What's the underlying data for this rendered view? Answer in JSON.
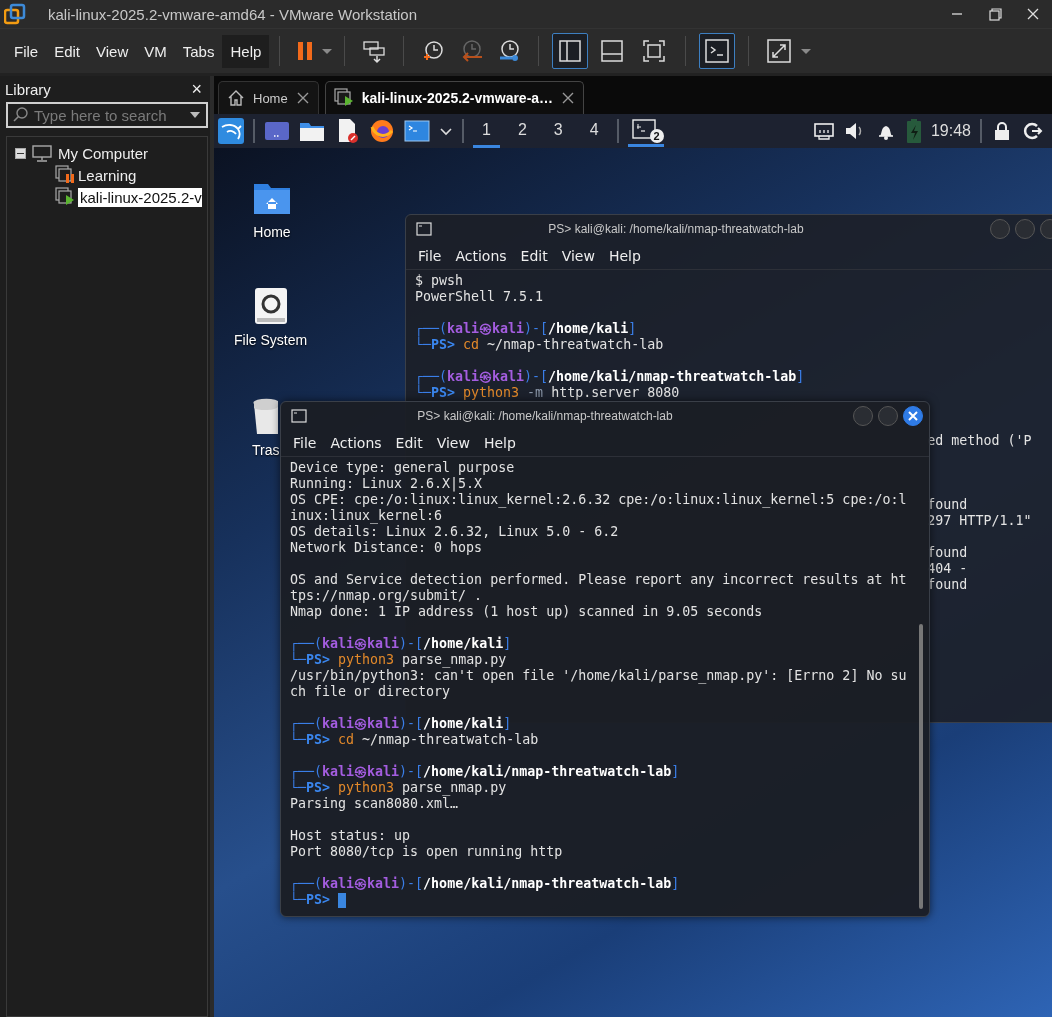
{
  "window": {
    "title": "kali-linux-2025.2-vmware-amd64 - VMware Workstation"
  },
  "menu": [
    {
      "label": "File",
      "selected": false
    },
    {
      "label": "Edit",
      "selected": false
    },
    {
      "label": "View",
      "selected": false
    },
    {
      "label": "VM",
      "selected": false
    },
    {
      "label": "Tabs",
      "selected": false
    },
    {
      "label": "Help",
      "selected": true
    }
  ],
  "toolbar": {
    "view_buttons": [
      {
        "selected": true
      },
      {
        "selected": false
      },
      {
        "selected": false
      }
    ],
    "console_view": {
      "selected": true
    }
  },
  "library": {
    "title": "Library",
    "close": "×",
    "search": {
      "placeholder": "Type here to search"
    },
    "tree": [
      {
        "label": "My Computer",
        "expanded": true,
        "children": [
          {
            "label": "Learning",
            "kind": "paused",
            "selected": false
          },
          {
            "label": "kali-linux-2025.2-v",
            "kind": "running",
            "selected": true
          }
        ]
      }
    ]
  },
  "tabs": [
    {
      "label": "Home",
      "kind": "home",
      "selected": false
    },
    {
      "label": "kali-linux-2025.2-vmware-a…",
      "kind": "vm",
      "selected": true
    }
  ],
  "kali_panel": {
    "workspaces": [
      {
        "label": "1",
        "selected": true
      },
      {
        "label": "2",
        "selected": false
      },
      {
        "label": "3",
        "selected": false
      },
      {
        "label": "4",
        "selected": false
      }
    ],
    "task_badge": "2",
    "clock": "19:48"
  },
  "desktop_icons": [
    {
      "label": "Home",
      "kind": "folder"
    },
    {
      "label": "File System",
      "kind": "drive"
    },
    {
      "label": "Tras",
      "kind": "trash"
    }
  ],
  "terminals": [
    {
      "title": "PS> kali@kali: /home/kali/nmap-threatwatch-lab",
      "active": false,
      "menu": [
        "File",
        "Actions",
        "Edit",
        "View",
        "Help"
      ],
      "lines": [
        {
          "kind": "text",
          "parts": [
            {
              "kind": "text",
              "text": "$ pwsh"
            }
          ]
        },
        {
          "kind": "text",
          "parts": [
            {
              "kind": "text",
              "text": "PowerShell 7.5.1"
            }
          ]
        },
        {
          "kind": "blank"
        },
        {
          "kind": "text",
          "parts": [
            {
              "kind": "frame",
              "text": "┌──("
            },
            {
              "kind": "user",
              "text": "kali㉿kali"
            },
            {
              "kind": "frame",
              "text": ")-["
            },
            {
              "kind": "path",
              "text": "/home/kali"
            },
            {
              "kind": "frame",
              "text": "]"
            }
          ]
        },
        {
          "kind": "text",
          "parts": [
            {
              "kind": "frame",
              "text": "└─"
            },
            {
              "kind": "ps",
              "text": "PS>"
            },
            {
              "kind": "cmd",
              "text": " cd"
            },
            {
              "kind": "text",
              "text": " ~/nmap-threatwatch-lab"
            }
          ]
        },
        {
          "kind": "blank"
        },
        {
          "kind": "text",
          "parts": [
            {
              "kind": "frame",
              "text": "┌──("
            },
            {
              "kind": "user",
              "text": "kali㉿kali"
            },
            {
              "kind": "frame",
              "text": ")-["
            },
            {
              "kind": "path",
              "text": "/home/kali/nmap-threatwatch-lab"
            },
            {
              "kind": "frame",
              "text": "]"
            }
          ]
        },
        {
          "kind": "text",
          "parts": [
            {
              "kind": "frame",
              "text": "└─"
            },
            {
              "kind": "ps",
              "text": "PS>"
            },
            {
              "kind": "cmd",
              "text": " python3"
            },
            {
              "kind": "opt",
              "text": " -m"
            },
            {
              "kind": "text",
              "text": " http.server 8080"
            }
          ]
        },
        {
          "kind": "blank"
        },
        {
          "kind": "blank"
        },
        {
          "kind": "tail",
          "parts": [
            {
              "kind": "text",
              "text": "ed method ('P"
            }
          ]
        },
        {
          "kind": "blank"
        },
        {
          "kind": "blank"
        },
        {
          "kind": "blank"
        },
        {
          "kind": "tail",
          "parts": [
            {
              "kind": "text",
              "text": "found"
            }
          ]
        },
        {
          "kind": "tail",
          "parts": [
            {
              "kind": "text",
              "text": "297 HTTP/1.1\""
            }
          ]
        },
        {
          "kind": "blank"
        },
        {
          "kind": "tail",
          "parts": [
            {
              "kind": "text",
              "text": "found"
            }
          ]
        },
        {
          "kind": "tail",
          "parts": [
            {
              "kind": "text",
              "text": "404 -"
            }
          ]
        },
        {
          "kind": "tail",
          "parts": [
            {
              "kind": "text",
              "text": "found"
            }
          ]
        }
      ]
    },
    {
      "title": "PS> kali@kali: /home/kali/nmap-threatwatch-lab",
      "active": true,
      "menu": [
        "File",
        "Actions",
        "Edit",
        "View",
        "Help"
      ],
      "lines": [
        {
          "kind": "text",
          "parts": [
            {
              "kind": "text",
              "text": "Device type: general purpose"
            }
          ]
        },
        {
          "kind": "text",
          "parts": [
            {
              "kind": "text",
              "text": "Running: Linux 2.6.X|5.X"
            }
          ]
        },
        {
          "kind": "text",
          "parts": [
            {
              "kind": "text",
              "text": "OS CPE: cpe:/o:linux:linux_kernel:2.6.32 cpe:/o:linux:linux_kernel:5 cpe:/o:l"
            }
          ]
        },
        {
          "kind": "text",
          "parts": [
            {
              "kind": "text",
              "text": "inux:linux_kernel:6"
            }
          ]
        },
        {
          "kind": "text",
          "parts": [
            {
              "kind": "text",
              "text": "OS details: Linux 2.6.32, Linux 5.0 - 6.2"
            }
          ]
        },
        {
          "kind": "text",
          "parts": [
            {
              "kind": "text",
              "text": "Network Distance: 0 hops"
            }
          ]
        },
        {
          "kind": "blank"
        },
        {
          "kind": "text",
          "parts": [
            {
              "kind": "text",
              "text": "OS and Service detection performed. Please report any incorrect results at ht"
            }
          ]
        },
        {
          "kind": "text",
          "parts": [
            {
              "kind": "text",
              "text": "tps://nmap.org/submit/ ."
            }
          ]
        },
        {
          "kind": "text",
          "parts": [
            {
              "kind": "text",
              "text": "Nmap done: 1 IP address (1 host up) scanned in 9.05 seconds"
            }
          ]
        },
        {
          "kind": "blank"
        },
        {
          "kind": "text",
          "parts": [
            {
              "kind": "frame",
              "text": "┌──("
            },
            {
              "kind": "user",
              "text": "kali㉿kali"
            },
            {
              "kind": "frame",
              "text": ")-["
            },
            {
              "kind": "path",
              "text": "/home/kali"
            },
            {
              "kind": "frame",
              "text": "]"
            }
          ]
        },
        {
          "kind": "text",
          "parts": [
            {
              "kind": "frame",
              "text": "└─"
            },
            {
              "kind": "ps",
              "text": "PS>"
            },
            {
              "kind": "cmd",
              "text": " python3"
            },
            {
              "kind": "text",
              "text": " parse_nmap.py"
            }
          ]
        },
        {
          "kind": "text",
          "parts": [
            {
              "kind": "text",
              "text": "/usr/bin/python3: can't open file '/home/kali/parse_nmap.py': [Errno 2] No su"
            }
          ]
        },
        {
          "kind": "text",
          "parts": [
            {
              "kind": "text",
              "text": "ch file or directory"
            }
          ]
        },
        {
          "kind": "blank"
        },
        {
          "kind": "text",
          "parts": [
            {
              "kind": "frame",
              "text": "┌──("
            },
            {
              "kind": "user",
              "text": "kali㉿kali"
            },
            {
              "kind": "frame",
              "text": ")-["
            },
            {
              "kind": "path",
              "text": "/home/kali"
            },
            {
              "kind": "frame",
              "text": "]"
            }
          ]
        },
        {
          "kind": "text",
          "parts": [
            {
              "kind": "frame",
              "text": "└─"
            },
            {
              "kind": "ps",
              "text": "PS>"
            },
            {
              "kind": "cmd",
              "text": " cd"
            },
            {
              "kind": "text",
              "text": " ~/nmap-threatwatch-lab"
            }
          ]
        },
        {
          "kind": "blank"
        },
        {
          "kind": "text",
          "parts": [
            {
              "kind": "frame",
              "text": "┌──("
            },
            {
              "kind": "user",
              "text": "kali㉿kali"
            },
            {
              "kind": "frame",
              "text": ")-["
            },
            {
              "kind": "path",
              "text": "/home/kali/nmap-threatwatch-lab"
            },
            {
              "kind": "frame",
              "text": "]"
            }
          ]
        },
        {
          "kind": "text",
          "parts": [
            {
              "kind": "frame",
              "text": "└─"
            },
            {
              "kind": "ps",
              "text": "PS>"
            },
            {
              "kind": "cmd",
              "text": " python3"
            },
            {
              "kind": "text",
              "text": " parse_nmap.py"
            }
          ]
        },
        {
          "kind": "text",
          "parts": [
            {
              "kind": "text",
              "text": "Parsing scan8080.xml…"
            }
          ]
        },
        {
          "kind": "blank"
        },
        {
          "kind": "text",
          "parts": [
            {
              "kind": "text",
              "text": "Host status: up"
            }
          ]
        },
        {
          "kind": "text",
          "parts": [
            {
              "kind": "text",
              "text": "Port 8080/tcp is open running http"
            }
          ]
        },
        {
          "kind": "blank"
        },
        {
          "kind": "text",
          "parts": [
            {
              "kind": "frame",
              "text": "┌──("
            },
            {
              "kind": "user",
              "text": "kali㉿kali"
            },
            {
              "kind": "frame",
              "text": ")-["
            },
            {
              "kind": "path",
              "text": "/home/kali/nmap-threatwatch-lab"
            },
            {
              "kind": "frame",
              "text": "]"
            }
          ]
        },
        {
          "kind": "input",
          "parts": [
            {
              "kind": "frame",
              "text": "└─"
            },
            {
              "kind": "ps",
              "text": "PS>"
            }
          ]
        }
      ]
    }
  ]
}
